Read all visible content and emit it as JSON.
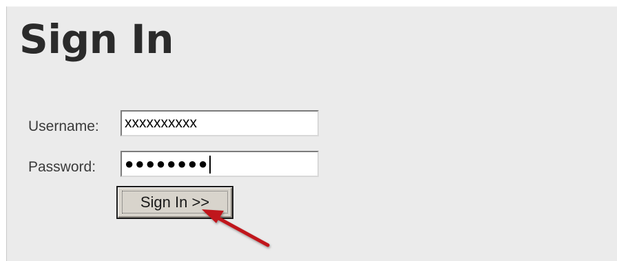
{
  "page": {
    "title": "Sign In"
  },
  "form": {
    "username_label": "Username:",
    "username_value": "xxxxxxxxxx",
    "password_label": "Password:",
    "password_value": "●●●●●●●●",
    "submit_label": "Sign In >>"
  },
  "annotation": {
    "arrow_color": "#c0171b"
  },
  "colors": {
    "panel_background": "#ebebeb",
    "button_face": "#d8d4cc"
  }
}
